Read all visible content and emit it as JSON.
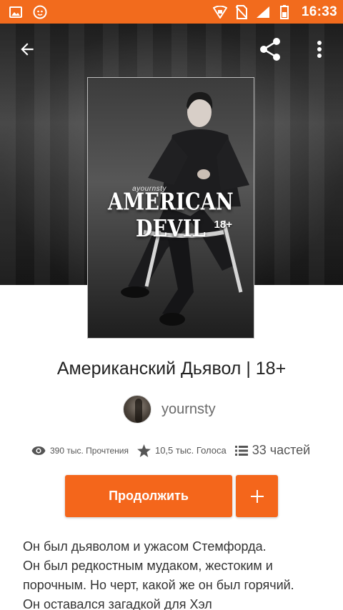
{
  "status_bar": {
    "time": "16:33",
    "left_icons": [
      "image-icon",
      "wattpad-lion-icon"
    ],
    "right_icons": [
      "signal-lock-icon",
      "sim-missing-icon",
      "signal-bars-icon",
      "battery-icon"
    ]
  },
  "top_bar": {
    "icons": [
      "back-arrow-icon",
      "share-icon",
      "more-vertical-icon"
    ]
  },
  "cover": {
    "watermark": "ayournsty",
    "title": "AMERICAN DEVIL",
    "rating": "18+"
  },
  "story": {
    "title": "Американский Дьявол | 18+",
    "author": "yournsty"
  },
  "stats": {
    "reads": "390 тыс. Прочтения",
    "votes": "10,5 тыс. Голоса",
    "parts": "33 частей"
  },
  "actions": {
    "continue_label": "Продолжить",
    "add_label": "+"
  },
  "description": {
    "lines": [
      "Он был дьяволом и ужасом Стемфорда.",
      "Он был редкостным мудаком, жестоким и",
      "порочным. Но черт, какой же он был горячий.",
      "Он оставался загадкой для Хэл"
    ]
  },
  "colors": {
    "accent": "#f4661b",
    "status_bar": "#f26b1d",
    "text_primary": "#222222",
    "text_secondary": "#555555"
  }
}
